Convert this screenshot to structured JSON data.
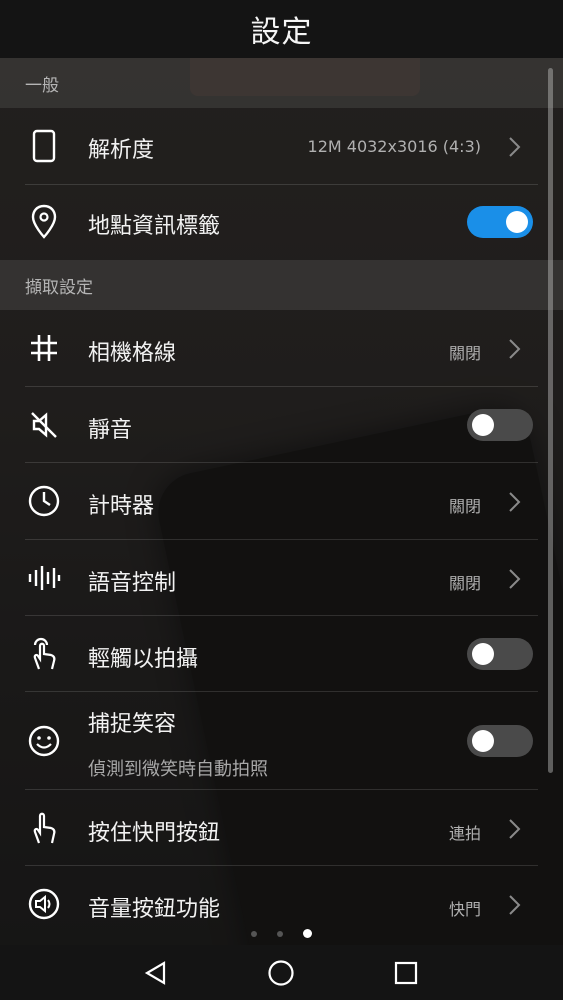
{
  "header": {
    "title": "設定"
  },
  "sections": [
    {
      "title": "一般"
    },
    {
      "title": "擷取設定"
    }
  ],
  "rows": {
    "resolution": {
      "label": "解析度",
      "value": "12M 4032x3016 (4:3)",
      "icon": "phone-outline-icon"
    },
    "location_tag": {
      "label": "地點資訊標籤",
      "toggle": true,
      "icon": "location-pin-icon"
    },
    "grid": {
      "label": "相機格線",
      "value": "關閉",
      "icon": "grid-icon"
    },
    "mute": {
      "label": "靜音",
      "toggle": false,
      "icon": "mute-icon"
    },
    "timer": {
      "label": "計時器",
      "value": "關閉",
      "icon": "clock-icon"
    },
    "voice_control": {
      "label": "語音控制",
      "value": "關閉",
      "icon": "voice-wave-icon"
    },
    "touch_capture": {
      "label": "輕觸以拍攝",
      "toggle": false,
      "icon": "touch-icon"
    },
    "smile_capture": {
      "label": "捕捉笑容",
      "sublabel": "偵測到微笑時自動拍照",
      "toggle": false,
      "icon": "smile-icon"
    },
    "hold_shutter": {
      "label": "按住快門按鈕",
      "value": "連拍",
      "icon": "hand-icon"
    },
    "volume_key": {
      "label": "音量按鈕功能",
      "value": "快門",
      "icon": "speaker-icon"
    }
  },
  "pager": {
    "count": 3,
    "active": 3
  },
  "colors": {
    "toggle_on": "#1a8fe8",
    "toggle_off": "#4a4a4a",
    "background": "#141414"
  }
}
